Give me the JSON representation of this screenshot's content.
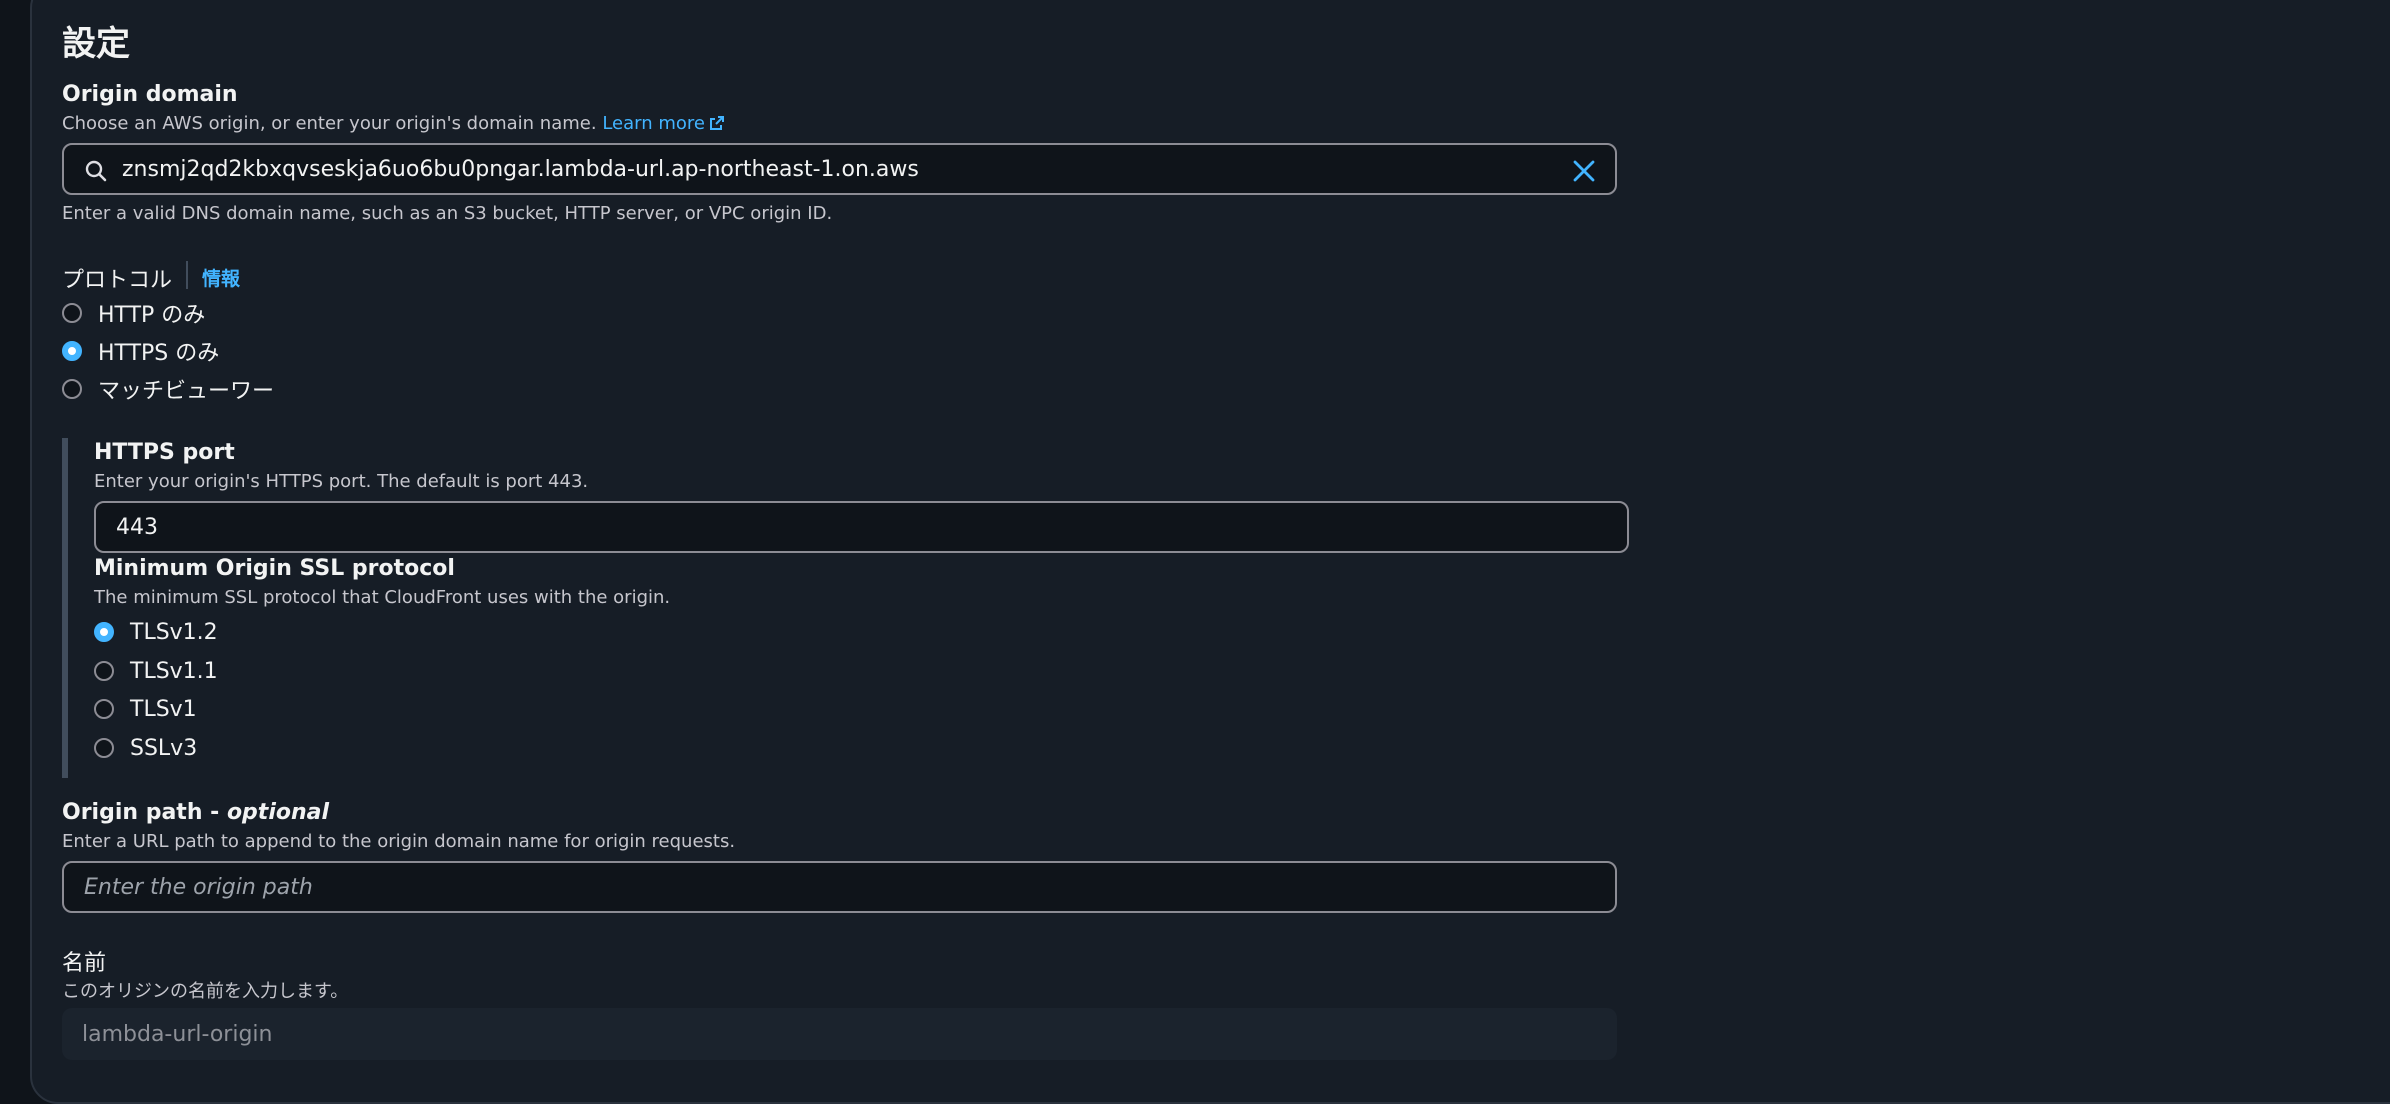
{
  "section": {
    "title": "設定"
  },
  "origin_domain": {
    "label": "Origin domain",
    "description": "Choose an AWS origin, or enter your origin's domain name.",
    "learn_more": "Learn more",
    "value": "znsmj2qd2kbxqvseskja6uo6bu0pngar.lambda-url.ap-northeast-1.on.aws",
    "hint": "Enter a valid DNS domain name, such as an S3 bucket, HTTP server, or VPC origin ID."
  },
  "protocol": {
    "label": "プロトコル",
    "info": "情報",
    "options": [
      {
        "label": "HTTP のみ",
        "checked": false
      },
      {
        "label": "HTTPS のみ",
        "checked": true
      },
      {
        "label": "マッチビューワー",
        "checked": false
      }
    ]
  },
  "https_port": {
    "label": "HTTPS port",
    "description": "Enter your origin's HTTPS port. The default is port 443.",
    "value": "443"
  },
  "min_ssl": {
    "label": "Minimum Origin SSL protocol",
    "description": "The minimum SSL protocol that CloudFront uses with the origin.",
    "options": [
      {
        "label": "TLSv1.2",
        "checked": true
      },
      {
        "label": "TLSv1.1",
        "checked": false
      },
      {
        "label": "TLSv1",
        "checked": false
      },
      {
        "label": "SSLv3",
        "checked": false
      }
    ]
  },
  "origin_path": {
    "label": "Origin path - ",
    "label_optional": "optional",
    "description": "Enter a URL path to append to the origin domain name for origin requests.",
    "placeholder": "Enter the origin path"
  },
  "name": {
    "label": "名前",
    "description": "このオリジンの名前を入力します。",
    "placeholder": "lambda-url-origin"
  },
  "colors": {
    "background": "#0f141a",
    "panel": "#161d26",
    "accent": "#42b4ff",
    "text": "#f2f3f3",
    "border": "#8c8c94"
  }
}
